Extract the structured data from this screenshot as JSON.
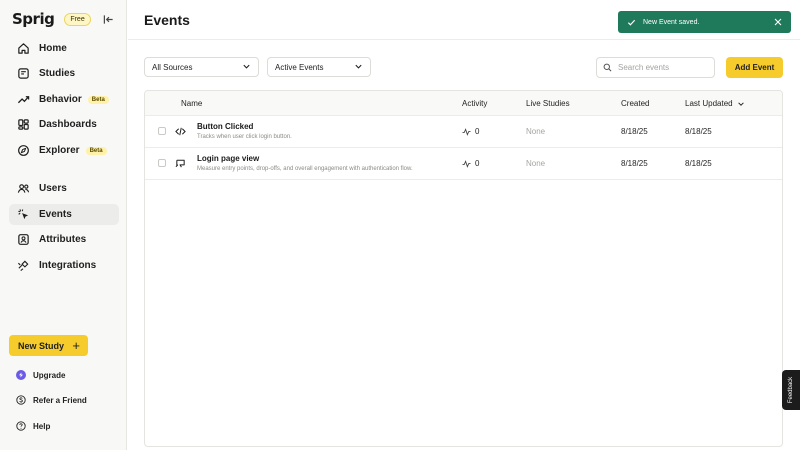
{
  "app": {
    "logo_text": "Sprig",
    "plan_badge": "Free"
  },
  "sidebar": {
    "primary": [
      {
        "label": "Home",
        "icon": "home-icon"
      },
      {
        "label": "Studies",
        "icon": "studies-icon"
      },
      {
        "label": "Behavior",
        "icon": "behavior-icon",
        "badge": "Beta"
      },
      {
        "label": "Dashboards",
        "icon": "dashboards-icon"
      },
      {
        "label": "Explorer",
        "icon": "explorer-icon",
        "badge": "Beta"
      }
    ],
    "secondary": [
      {
        "label": "Users",
        "icon": "users-icon"
      },
      {
        "label": "Events",
        "icon": "events-icon",
        "active": true
      },
      {
        "label": "Attributes",
        "icon": "attributes-icon"
      },
      {
        "label": "Integrations",
        "icon": "integrations-icon"
      }
    ],
    "new_study_label": "New Study",
    "new_study_plus": "+",
    "footer": [
      {
        "label": "Upgrade",
        "icon": "upgrade-icon"
      },
      {
        "label": "Refer a Friend",
        "icon": "dollar-icon"
      },
      {
        "label": "Help",
        "icon": "help-icon"
      }
    ]
  },
  "page": {
    "title": "Events"
  },
  "toast": {
    "message": "New Event saved.",
    "color": "#1f7a5c"
  },
  "filters": {
    "source_select": "All Sources",
    "status_select": "Active Events"
  },
  "search": {
    "placeholder": "Search events"
  },
  "add_event_label": "Add Event",
  "table": {
    "headers": {
      "name": "Name",
      "activity": "Activity",
      "live_studies": "Live Studies",
      "created": "Created",
      "last_updated": "Last Updated"
    },
    "rows": [
      {
        "icon": "code-icon",
        "name": "Button Clicked",
        "description": "Tracks when user click login button.",
        "activity": "0",
        "live_studies": "None",
        "created": "8/18/25",
        "last_updated": "8/18/25"
      },
      {
        "icon": "page-view-icon",
        "name": "Login page view",
        "description": "Measure entry points, drop-offs, and overall engagement with authentication flow.",
        "activity": "0",
        "live_studies": "None",
        "created": "8/18/25",
        "last_updated": "8/18/25"
      }
    ]
  },
  "feedback_label": "Feedback",
  "colors": {
    "accent": "#f5cc2c",
    "toast": "#1f7a5c",
    "upgrade": "#6b5ce7"
  }
}
